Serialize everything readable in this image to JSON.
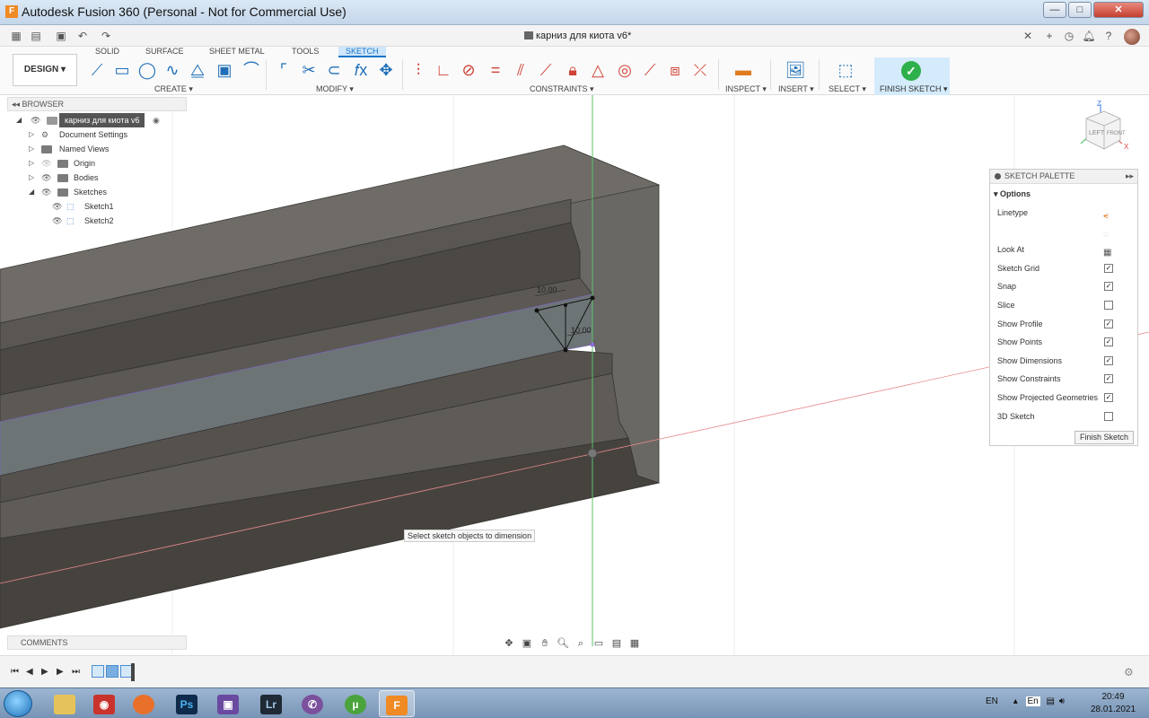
{
  "window": {
    "title": "Autodesk Fusion 360 (Personal - Not for Commercial Use)",
    "logo_letter": "F",
    "min": "—",
    "max": "□",
    "close": "✕"
  },
  "document": {
    "tab_title": "карниз для киота v6*",
    "close": "✕"
  },
  "ribbon": {
    "design_label": "DESIGN ▾",
    "tabs": [
      "SOLID",
      "SURFACE",
      "SHEET METAL",
      "TOOLS",
      "SKETCH"
    ],
    "active_tab": "SKETCH",
    "groups": {
      "create": "CREATE ▾",
      "modify": "MODIFY ▾",
      "constraints": "CONSTRAINTS ▾",
      "inspect": "INSPECT ▾",
      "insert": "INSERT ▾",
      "select": "SELECT ▾",
      "finish": "FINISH SKETCH ▾"
    }
  },
  "browser": {
    "header": "BROWSER",
    "root": "карниз для киота v6",
    "items": [
      {
        "label": "Document Settings"
      },
      {
        "label": "Named Views"
      },
      {
        "label": "Origin"
      },
      {
        "label": "Bodies"
      },
      {
        "label": "Sketches"
      }
    ],
    "sketches": [
      "Sketch1",
      "Sketch2"
    ]
  },
  "comments": {
    "label": "COMMENTS"
  },
  "viewcube": {
    "left": "LEFT",
    "front": "FRONT",
    "z": "Z",
    "x": "X"
  },
  "dimensions": {
    "d1": "10.00",
    "d2": "10.00"
  },
  "palette": {
    "header": "SKETCH PALETTE",
    "section": "Options",
    "options": [
      {
        "label": "Linetype",
        "type": "icon",
        "checked": null
      },
      {
        "label": "",
        "type": "icon2",
        "checked": null
      },
      {
        "label": "Look At",
        "type": "icon3",
        "checked": null
      },
      {
        "label": "Sketch Grid",
        "type": "check",
        "checked": true
      },
      {
        "label": "Snap",
        "type": "check",
        "checked": true
      },
      {
        "label": "Slice",
        "type": "check",
        "checked": false
      },
      {
        "label": "Show Profile",
        "type": "check",
        "checked": true
      },
      {
        "label": "Show Points",
        "type": "check",
        "checked": true
      },
      {
        "label": "Show Dimensions",
        "type": "check",
        "checked": true
      },
      {
        "label": "Show Constraints",
        "type": "check",
        "checked": true
      },
      {
        "label": "Show Projected Geometries",
        "type": "check",
        "checked": true
      },
      {
        "label": "3D Sketch",
        "type": "check",
        "checked": false
      }
    ],
    "finish_button": "Finish Sketch"
  },
  "tooltip": "Select sketch objects to dimension",
  "taskbar": {
    "apps": [
      "Explorer",
      "Screenshot",
      "Firefox",
      "Ps",
      "Disk",
      "Lr",
      "Viber",
      "µTorrent",
      "Fusion 360"
    ],
    "lang": "EN",
    "lang2": "En",
    "time": "20:49",
    "date": "28.01.2021"
  },
  "colors": {
    "accent": "#1a76c8",
    "finish_green": "#2eb04a",
    "model_gray": "#4d4a46"
  }
}
